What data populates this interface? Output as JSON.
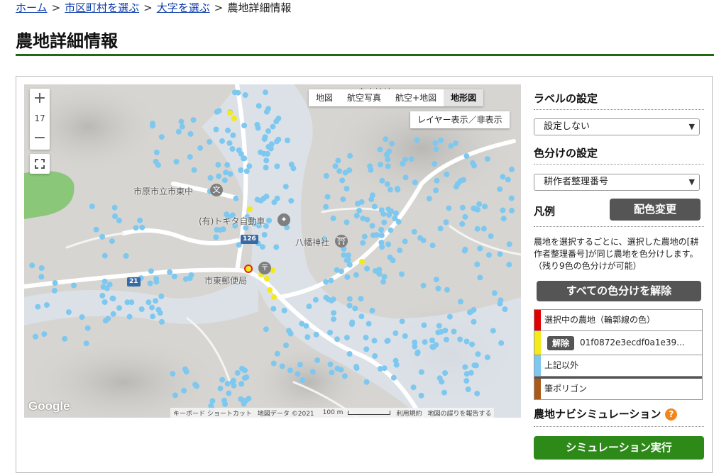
{
  "breadcrumb": {
    "home": "ホーム",
    "city": "市区町村を選ぶ",
    "district": "大字を選ぶ",
    "current": "農地詳細情報",
    "separator": ">"
  },
  "page": {
    "title": "農地詳細情報"
  },
  "map": {
    "zoom_in": "+",
    "zoom_level": "17",
    "zoom_out": "−",
    "map_types": [
      "地図",
      "航空写真",
      "航空+地図",
      "地形図"
    ],
    "active_map_type": "地形図",
    "layer_toggle": "レイヤー表示／非表示",
    "google_logo": "Google",
    "footer": {
      "shortcuts": "キーボード ショートカット",
      "map_data": "地図データ ©2021",
      "scale": "100 m",
      "terms": "利用規約",
      "report": "地図の誤りを報告する"
    },
    "labels": {
      "school": "市原市立市東中",
      "company": "(有)トキタ自動車",
      "shrine": "八幡神社",
      "post_office": "市東郵便局",
      "top_shrine": "白山神社"
    },
    "road_badges": [
      "126",
      "21"
    ],
    "colors": {
      "field_default": "#7ec8ef",
      "field_selected": "#f2ea1a",
      "selected_outline": "#e1261c",
      "polygon_green": "#7cc46a"
    }
  },
  "sidebar": {
    "label_heading": "ラベルの設定",
    "label_select_value": "設定しない",
    "color_heading": "色分けの設定",
    "color_select_value": "耕作者整理番号",
    "legend_heading": "凡例",
    "recolor_button": "配色変更",
    "description": "農地を選択するごとに、選択した農地の[耕作者整理番号]が同じ農地を色分けします。（残り9色の色分けが可能）",
    "clear_all_button": "すべての色分けを解除",
    "legend": [
      {
        "color": "#e00000",
        "label": "選択中の農地（輪郭線の色）"
      },
      {
        "color": "#f2ea1a",
        "button": "解除",
        "label": "01f0872e3ecdf0a1e39…"
      },
      {
        "color": "#7ec8ef",
        "label": "上記以外"
      },
      {
        "color": "#a85a1c",
        "label": "筆ポリゴン"
      }
    ],
    "sim_heading": "農地ナビシミュレーション",
    "help_icon": "?",
    "sim_button": "シミュレーション実行"
  }
}
